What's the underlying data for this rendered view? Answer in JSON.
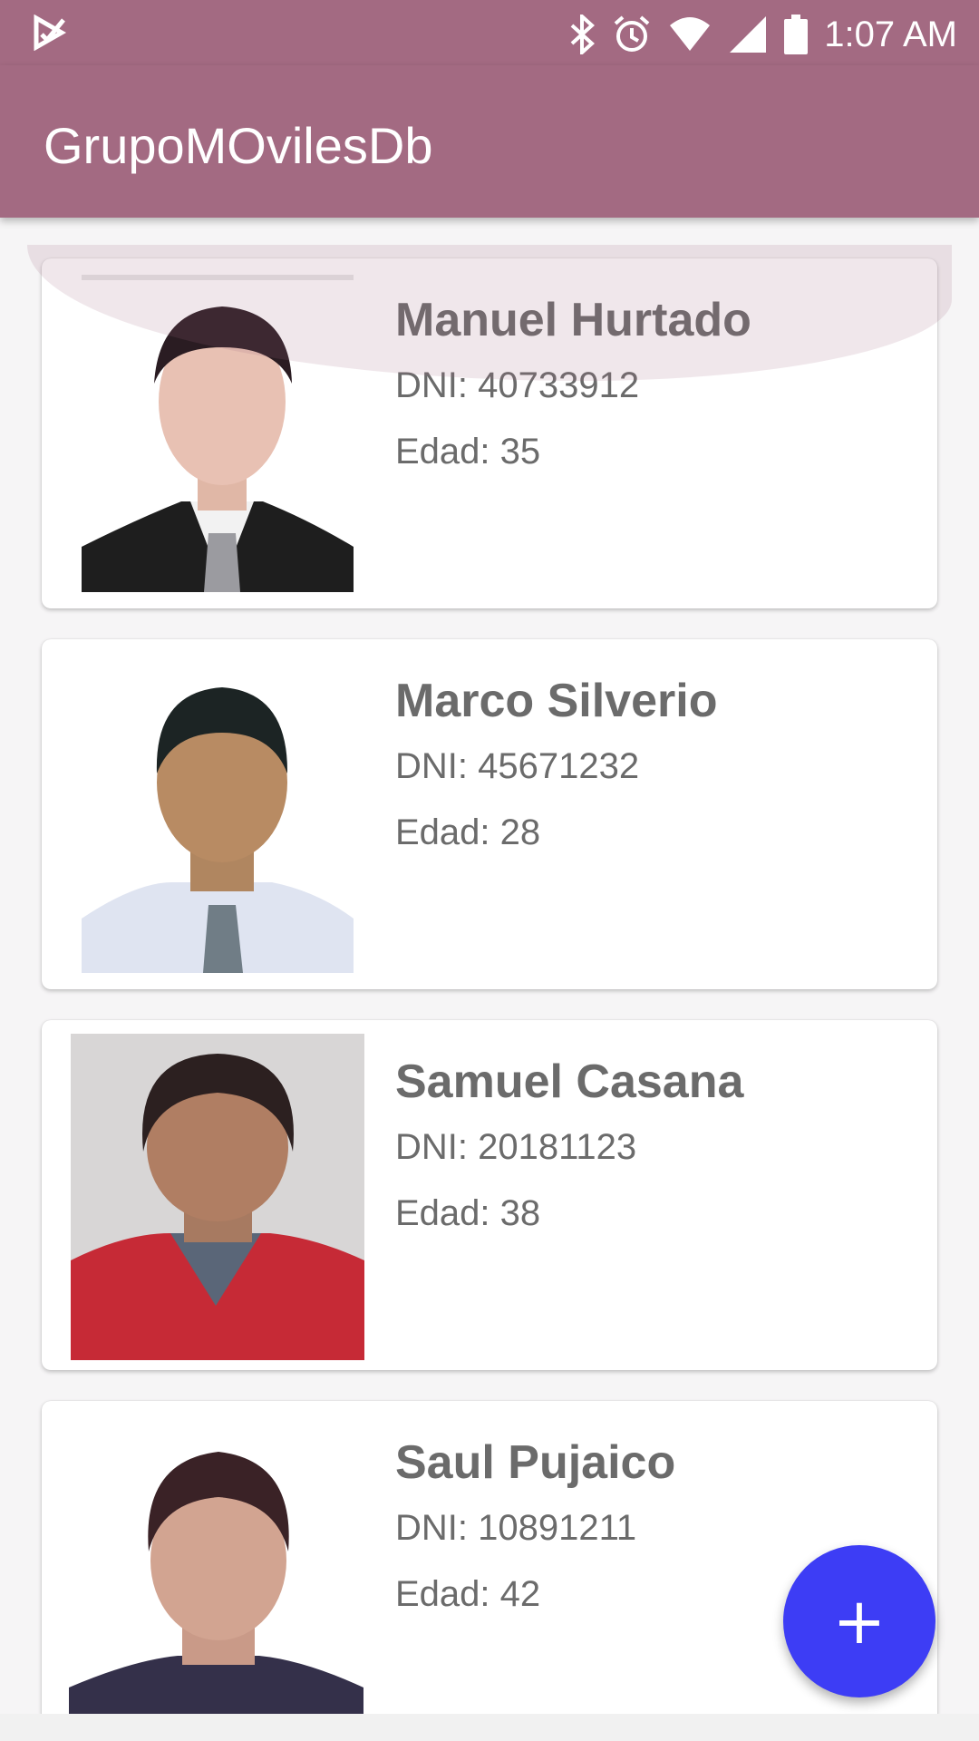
{
  "status_bar": {
    "time": "1:07 AM",
    "icons": [
      "check-app-icon",
      "bluetooth-icon",
      "alarm-icon",
      "wifi-icon",
      "signal-icon",
      "battery-icon"
    ]
  },
  "app_bar": {
    "title": "GrupoMOvilesDb"
  },
  "people": [
    {
      "name": "Manuel Hurtado",
      "dni": "DNI: 40733912",
      "age": "Edad: 35",
      "photo": "person-photo-1"
    },
    {
      "name": "Marco Silverio",
      "dni": "DNI: 45671232",
      "age": "Edad: 28",
      "photo": "person-photo-2"
    },
    {
      "name": "Samuel Casana",
      "dni": "DNI: 20181123",
      "age": "Edad: 38",
      "photo": "person-photo-3"
    },
    {
      "name": "Saul Pujaico",
      "dni": "DNI: 10891211",
      "age": "Edad: 42",
      "photo": "person-photo-4"
    }
  ],
  "fab": {
    "label": "+",
    "icon": "add-icon",
    "color": "#3d3df5"
  },
  "colors": {
    "primary": "#a36a82",
    "background": "#f6f5f6",
    "text": "#6b6b6b"
  }
}
